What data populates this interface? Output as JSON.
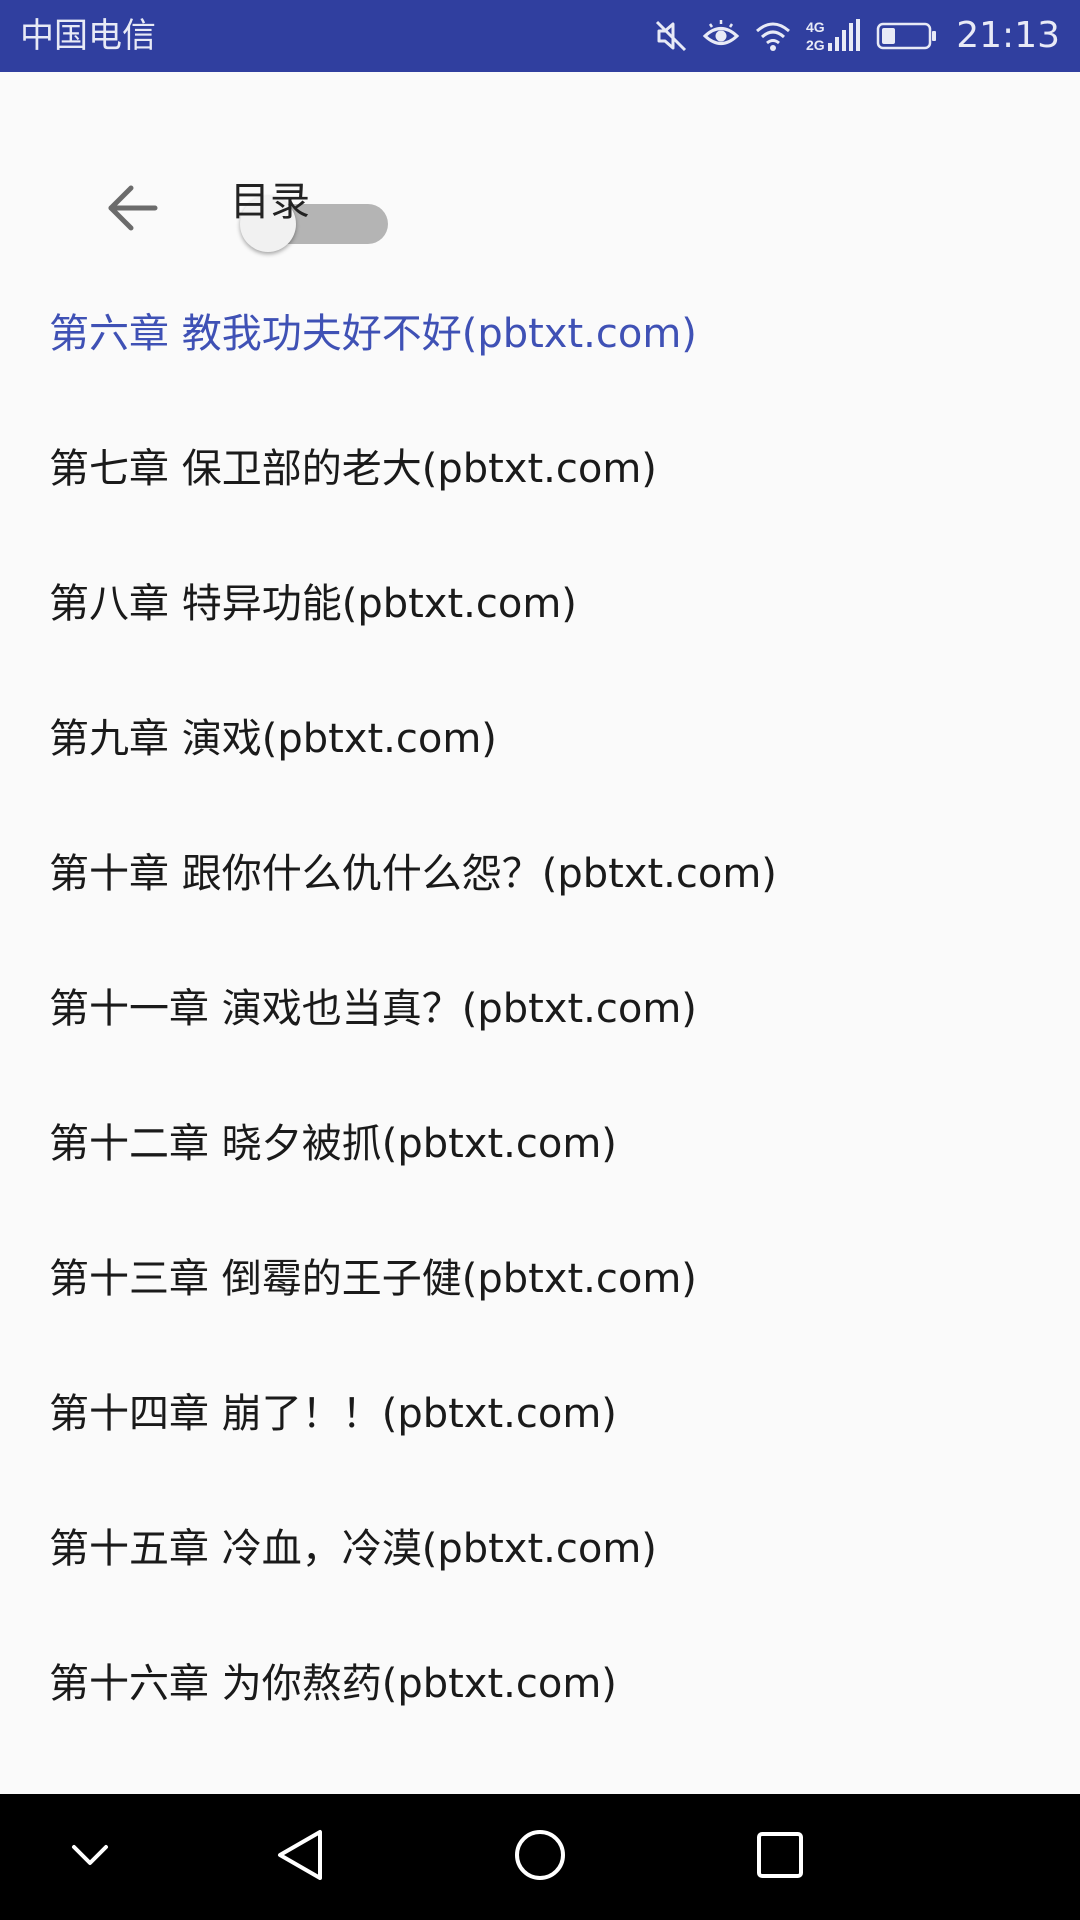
{
  "status_bar": {
    "carrier": "中国电信",
    "network_label_top": "4G",
    "network_label_bottom": "2G",
    "time": "21:13",
    "icons": [
      "mute-icon",
      "eye-comfort-icon",
      "wifi-icon",
      "signal-icon",
      "battery-icon"
    ],
    "background_color": "#303f9f"
  },
  "toolbar": {
    "back_icon": "arrow-left-icon",
    "title": "目录",
    "switch_on": false
  },
  "chapters": [
    {
      "label": "第六章 教我功夫好不好(pbtxt.com)",
      "current": true
    },
    {
      "label": "第七章 保卫部的老大(pbtxt.com)",
      "current": false
    },
    {
      "label": "第八章 特异功能(pbtxt.com)",
      "current": false
    },
    {
      "label": "第九章 演戏(pbtxt.com)",
      "current": false
    },
    {
      "label": "第十章 跟你什么仇什么怨？(pbtxt.com)",
      "current": false
    },
    {
      "label": "第十一章 演戏也当真？(pbtxt.com)",
      "current": false
    },
    {
      "label": "第十二章 晓夕被抓(pbtxt.com)",
      "current": false
    },
    {
      "label": "第十三章 倒霉的王子健(pbtxt.com)",
      "current": false
    },
    {
      "label": "第十四章 崩了！！(pbtxt.com)",
      "current": false
    },
    {
      "label": "第十五章 冷血，冷漠(pbtxt.com)",
      "current": false
    },
    {
      "label": "第十六章 为你熬药(pbtxt.com)",
      "current": false
    }
  ],
  "colors": {
    "accent": "#3f51b5",
    "text": "#1a1a1a",
    "background": "#fafafa"
  },
  "nav_bar": {
    "icons": [
      "hide-nav-icon",
      "back-triangle-icon",
      "home-circle-icon",
      "recents-square-icon"
    ]
  }
}
